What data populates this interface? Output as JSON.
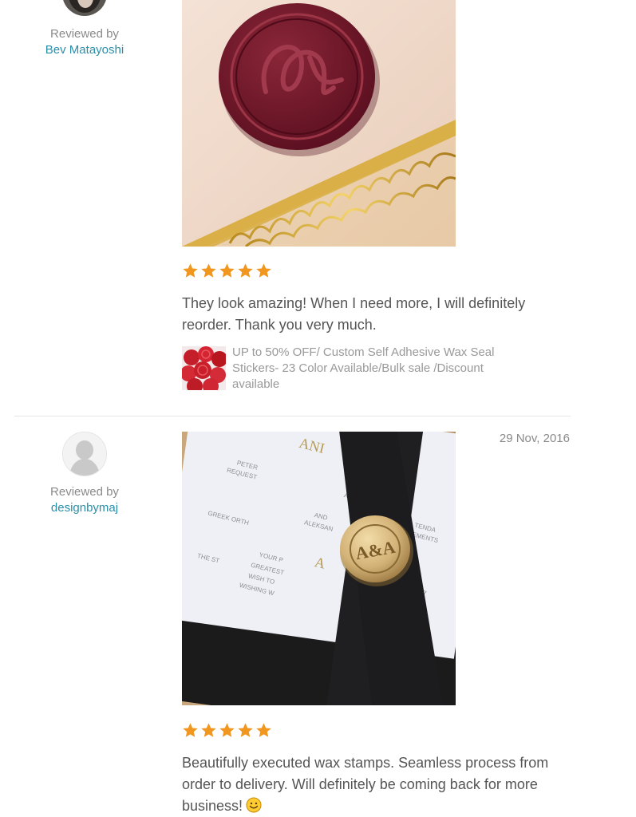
{
  "reviews": [
    {
      "reviewed_by_label": "Reviewed by",
      "reviewer_name": "Bev Matayoshi",
      "rating": 5,
      "text": "They look amazing! When I need more, I will definitely reorder. Thank you very much.",
      "listing_title": "UP to 50% OFF/ Custom Self Adhesive Wax Seal Stickers- 23 Color Available/Bulk sale /Discount available",
      "photo_icon": "wax-seal-monogram-photo"
    },
    {
      "reviewed_by_label": "Reviewed by",
      "reviewer_name": "designbymaj",
      "date": "29 Nov, 2016",
      "rating": 5,
      "text": "Beautifully executed wax stamps. Seamless process from order to delivery. Will definitely be coming back for more business!",
      "photo_icon": "wedding-invitation-seal-photo"
    }
  ],
  "colors": {
    "star": "#f1961f",
    "link": "#2b8ea8",
    "muted": "#8a8a8a",
    "body_text": "#555555"
  }
}
